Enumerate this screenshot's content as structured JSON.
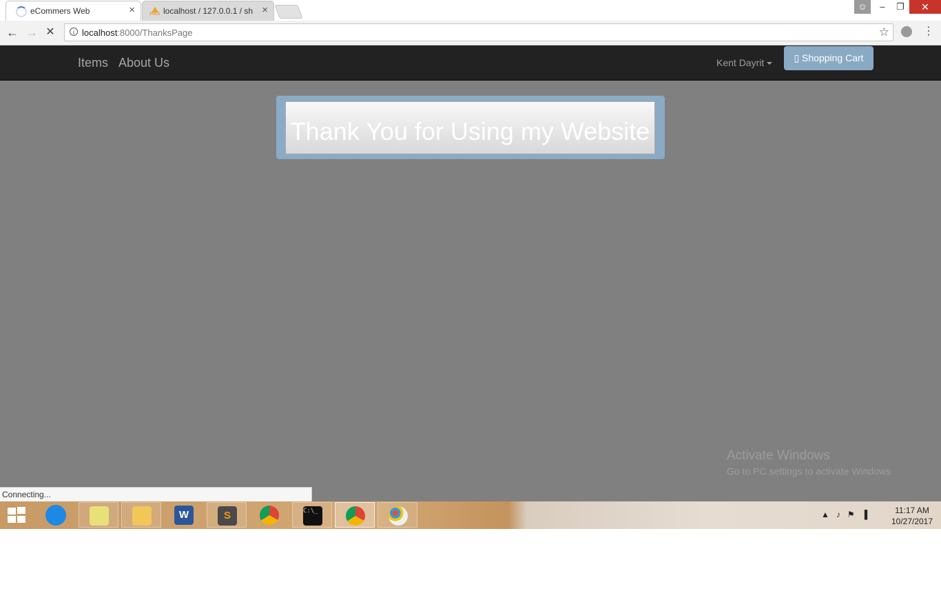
{
  "browser": {
    "tabs": [
      {
        "title": "eCommers Web",
        "active": true,
        "icon": "loading-spinner-icon"
      },
      {
        "title": "localhost / 127.0.0.1 / sh",
        "active": false,
        "icon": "phpmyadmin-icon"
      }
    ],
    "url_host": "localhost",
    "url_path": ":8000/ThanksPage",
    "status": "Connecting..."
  },
  "site": {
    "nav": {
      "items": "Items",
      "about": "About Us"
    },
    "user": "Kent Dayrit",
    "cart_label": "Shopping Cart",
    "cart_icon": "shopping-cart-icon",
    "thanks": "Thank You for Using my Website",
    "colors": {
      "navbar": "#222222",
      "page_bg": "#808080",
      "accent": "#8aabc5"
    }
  },
  "os": {
    "watermark_title": "Activate Windows",
    "watermark_sub": "Go to PC settings to activate Windows.",
    "time": "11:17 AM",
    "date": "10/27/2017",
    "tray_arrow": "▲"
  }
}
